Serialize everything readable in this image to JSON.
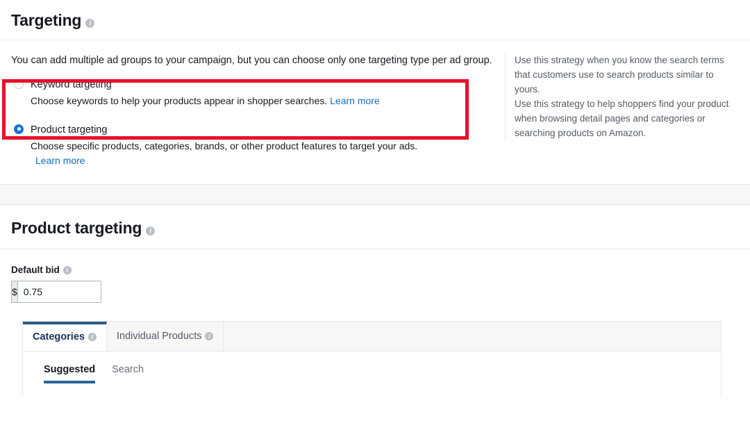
{
  "targeting_section": {
    "title": "Targeting",
    "info_icon": "info-icon",
    "intro": "You can add multiple ad groups to your campaign, but you can choose only one targeting type per ad group.",
    "options": [
      {
        "label": "Keyword targeting",
        "description": "Choose keywords to help your products appear in shopper searches.",
        "learn_more": "Learn more",
        "selected": false
      },
      {
        "label": "Product targeting",
        "description": "Choose specific products, categories, brands, or other product features to target your ads.",
        "learn_more": "Learn more",
        "selected": true
      }
    ],
    "help": {
      "paragraph_1": "Use this strategy when you know the search terms that customers use to search products similar to yours.",
      "paragraph_2": "Use this strategy to help shoppers find your product when browsing detail pages and categories or searching products on Amazon."
    },
    "highlight_color": "#e8102a"
  },
  "product_targeting_section": {
    "title": "Product targeting",
    "info_icon": "info-icon",
    "default_bid": {
      "label": "Default bid",
      "currency_symbol": "$",
      "value": "0.75",
      "placeholder": "0.00"
    },
    "tabs": [
      {
        "label": "Categories",
        "active": true,
        "has_info": true
      },
      {
        "label": "Individual Products",
        "active": false,
        "has_info": true
      }
    ],
    "subtabs": [
      {
        "label": "Suggested",
        "active": true
      },
      {
        "label": "Search",
        "active": false
      }
    ]
  },
  "colors": {
    "link": "#0f6fb8",
    "radio_selected": "#1b74d4",
    "active_tab_bar": "#2a5c87",
    "highlight": "#e8102a"
  }
}
